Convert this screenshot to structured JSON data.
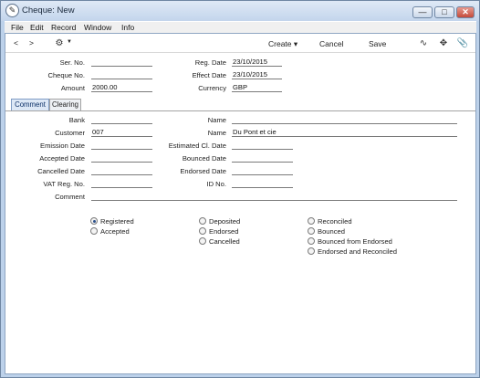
{
  "window": {
    "title": "Cheque: New",
    "icon": "cheque-app-icon"
  },
  "window_buttons": [
    "—",
    "□",
    "✕"
  ],
  "menu": [
    "File",
    "Edit",
    "Record",
    "Window",
    "Info"
  ],
  "toolbar": {
    "prev": "<",
    "next": ">",
    "create": "Create",
    "cancel": "Cancel",
    "save": "Save"
  },
  "header": {
    "ser_no": {
      "label": "Ser. No.",
      "value": ""
    },
    "cheque_no": {
      "label": "Cheque No.",
      "value": ""
    },
    "amount": {
      "label": "Amount",
      "value": "2000.00"
    },
    "reg_date": {
      "label": "Reg. Date",
      "value": "23/10/2015"
    },
    "effect_date": {
      "label": "Effect Date",
      "value": "23/10/2015"
    },
    "currency": {
      "label": "Currency",
      "value": "GBP"
    }
  },
  "tabs": [
    "Comment",
    "Clearing"
  ],
  "comment_tab": {
    "bank": {
      "label": "Bank",
      "value": ""
    },
    "customer": {
      "label": "Customer",
      "value": "007"
    },
    "emission_date": {
      "label": "Emission Date",
      "value": ""
    },
    "accepted_date": {
      "label": "Accepted Date",
      "value": ""
    },
    "cancelled_date": {
      "label": "Cancelled Date",
      "value": ""
    },
    "vat_reg_no": {
      "label": "VAT Reg. No.",
      "value": ""
    },
    "comment": {
      "label": "Comment",
      "value": ""
    },
    "name1": {
      "label": "Name",
      "value": ""
    },
    "name2": {
      "label": "Name",
      "value": "Du Pont et cie"
    },
    "est_cl_date": {
      "label": "Estimated Cl. Date",
      "value": ""
    },
    "bounced_date": {
      "label": "Bounced Date",
      "value": ""
    },
    "endorsed_date": {
      "label": "Endorsed Date",
      "value": ""
    },
    "id_no": {
      "label": "ID No.",
      "value": ""
    }
  },
  "status_options": {
    "selected": "Registered",
    "col1": [
      "Registered",
      "Accepted"
    ],
    "col2": [
      "Deposited",
      "Endorsed",
      "Cancelled"
    ],
    "col3": [
      "Reconciled",
      "Bounced",
      "Bounced from Endorsed",
      "Endorsed and Reconciled"
    ]
  }
}
